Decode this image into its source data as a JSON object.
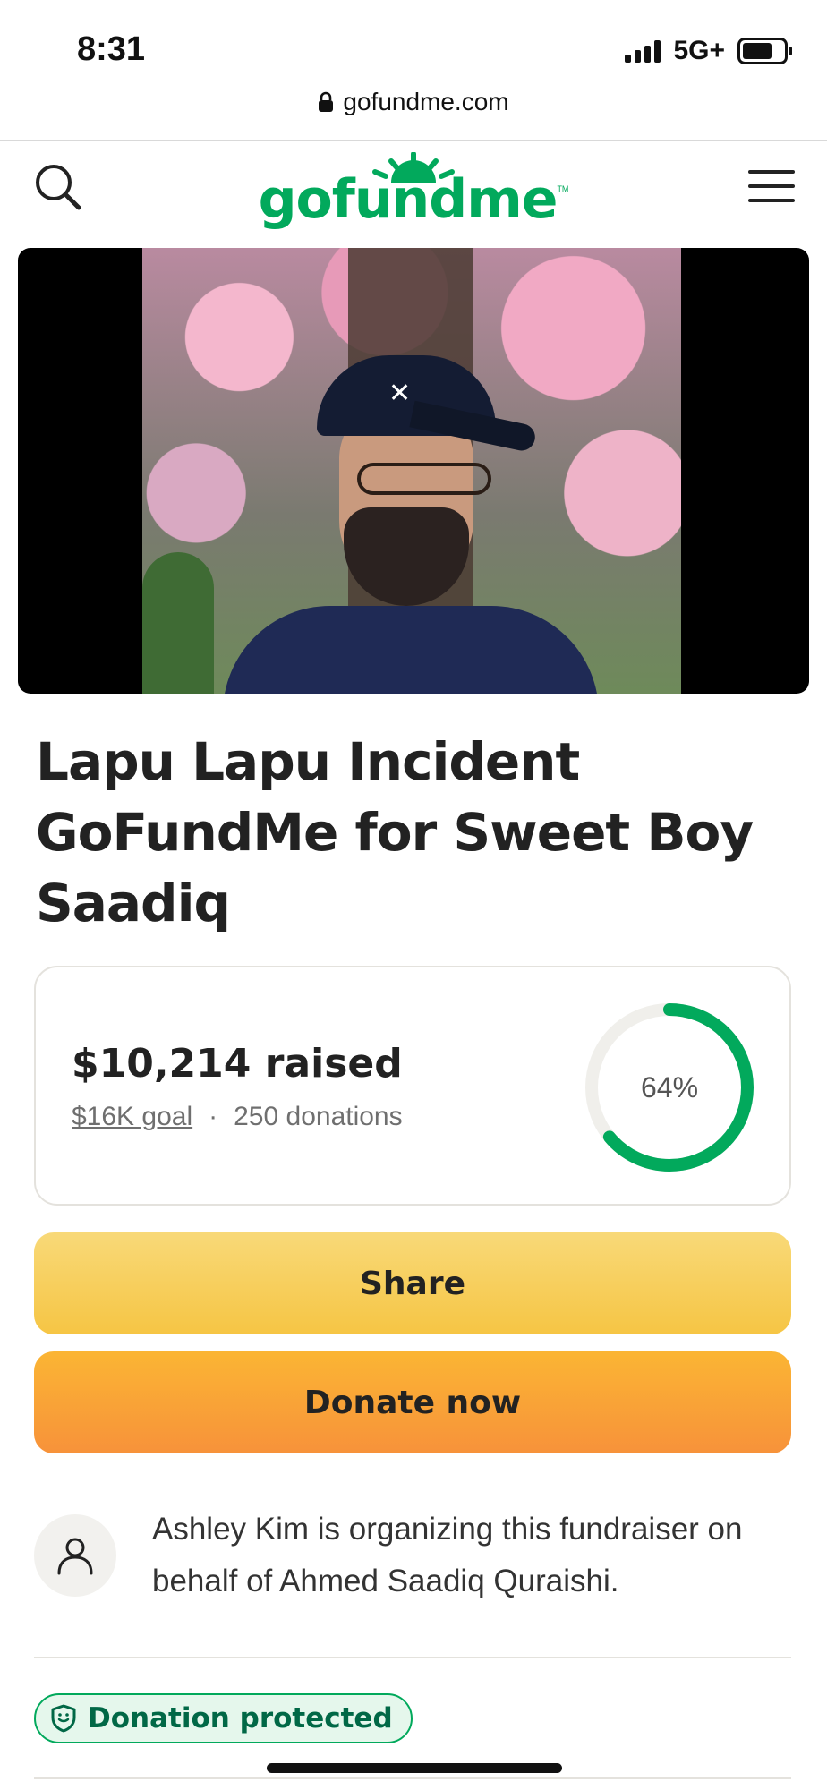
{
  "status_bar": {
    "time": "8:31",
    "network": "5G+"
  },
  "browser": {
    "url": "gofundme.com"
  },
  "header": {
    "logo": "gofundme",
    "logo_tm": "TM"
  },
  "campaign": {
    "title": "Lapu Lapu Incident GoFundMe for Sweet Boy Saadiq",
    "raised": "$10,214 raised",
    "goal": "$16K goal",
    "separator": "·",
    "donations": "250 donations",
    "progress_label": "64%",
    "progress_fraction": 0.64
  },
  "actions": {
    "share_label": "Share",
    "donate_label": "Donate now"
  },
  "organizer": {
    "text": "Ashley Kim is organizing this fundraiser on behalf of Ahmed Saadiq Quraishi."
  },
  "badge": {
    "label": "Donation protected"
  },
  "colors": {
    "brand_green": "#02a95c",
    "share_yellow": "#f6c544",
    "donate_orange": "#f7923a",
    "track_gray": "#f0efeb"
  }
}
